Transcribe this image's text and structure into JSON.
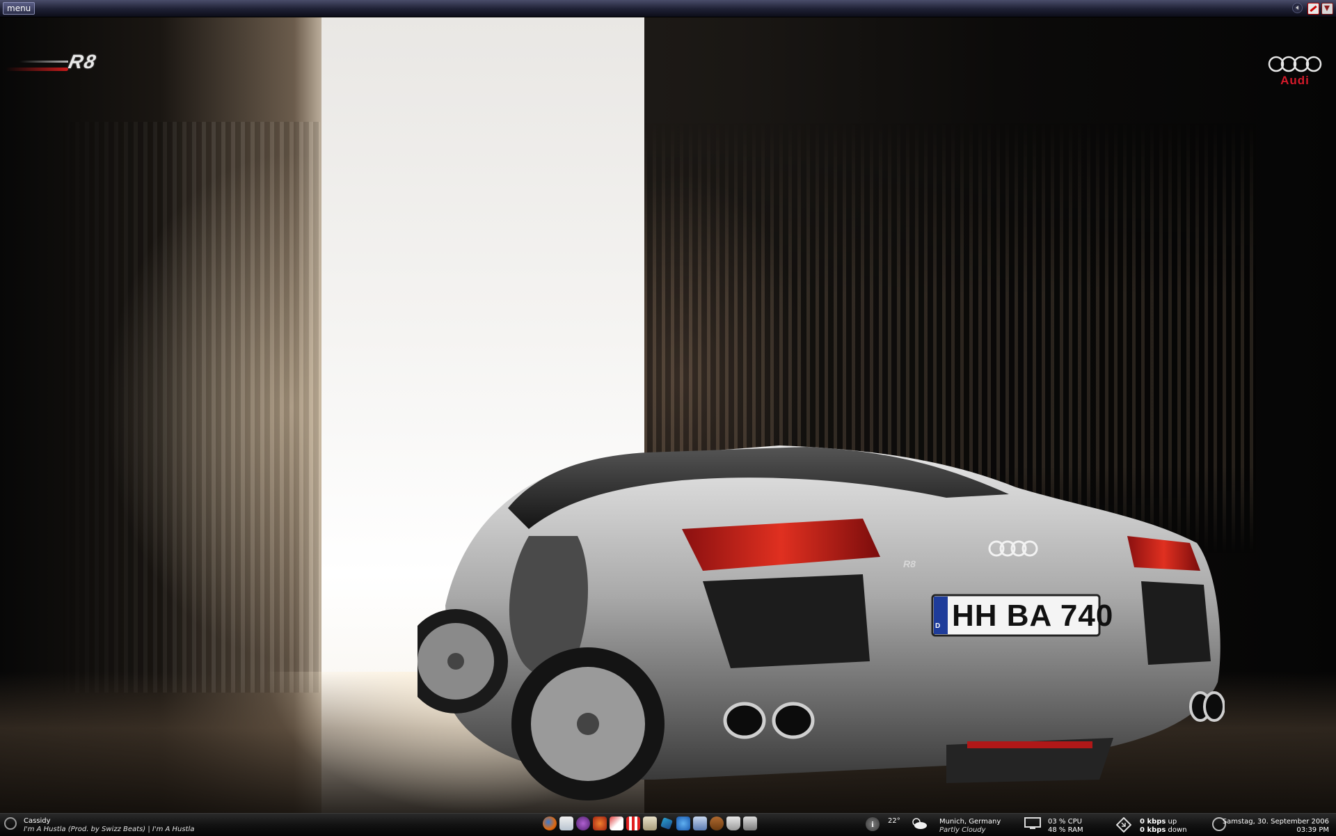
{
  "topbar": {
    "menu_label": "menu",
    "tray_icons": [
      "back-arrow-icon",
      "pdf-icon",
      "download-icon"
    ]
  },
  "wallpaper": {
    "logo_left_text": "R8",
    "logo_right_text": "Audi",
    "license_plate": "HH BA 740",
    "plate_country": "D",
    "badge_text": "R8",
    "accent_color": "#d41a2a"
  },
  "taskbar": {
    "now_playing": {
      "artist": "Cassidy",
      "track": "I'm A Hustla (Prod. by Swizz Beats) | I'm A Hustla"
    },
    "dock_icons": [
      "firefox-icon",
      "mail-icon",
      "game-icon",
      "character-icon",
      "notes-icon",
      "popcorn-icon",
      "cards-icon",
      "tool-icon",
      "paint-icon",
      "network-icon",
      "image-icon",
      "coffee-icon",
      "shoe-icon"
    ],
    "weather": {
      "temp": "22°",
      "city": "Munich, Germany",
      "condition": "Partly Cloudy"
    },
    "system": {
      "cpu": "03 % CPU",
      "ram": "48 % RAM"
    },
    "network": {
      "up_value": "0 kbps",
      "up_label": "up",
      "down_value": "0 kbps",
      "down_label": "down"
    },
    "clock": {
      "date": "Samstag, 30. September 2006",
      "time": "03:39 PM"
    }
  }
}
